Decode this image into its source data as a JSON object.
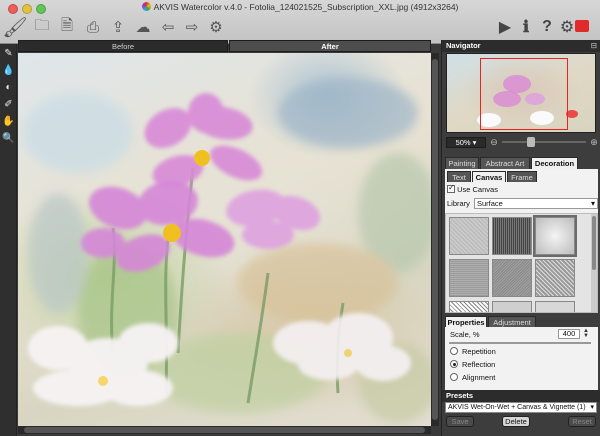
{
  "window": {
    "title": "AKVIS Watercolor v.4.0 - Fotolia_124021525_Subscription_XXL.jpg (4912x3264)"
  },
  "toolbar": {
    "left_icons": [
      "brush-logo-icon",
      "open-icon",
      "save-icon",
      "print-icon",
      "share-icon",
      "preferences-icon",
      "undo-icon",
      "redo-icon",
      "settings-gear-icon"
    ],
    "right_icons": [
      "run-icon",
      "info-icon",
      "help-icon",
      "program-settings-icon",
      "close-plugin-icon"
    ]
  },
  "tools": [
    "brush-tool-icon",
    "dropper-tool-icon",
    "color-history-icon",
    "eraser-tool-icon",
    "hand-tool-icon",
    "zoom-tool-icon"
  ],
  "view_tabs": {
    "before": "Before",
    "after": "After",
    "active": "After"
  },
  "navigator": {
    "title": "Navigator",
    "zoom": "50%",
    "zoom_slider_fraction": 0.35
  },
  "main_tabs": {
    "items": [
      "Painting",
      "Abstract Art",
      "Decoration"
    ],
    "active": "Decoration"
  },
  "sub_tabs": {
    "items": [
      "Text",
      "Canvas",
      "Frame"
    ],
    "active": "Canvas"
  },
  "canvas": {
    "use_canvas_label": "Use Canvas",
    "use_canvas_checked": true,
    "library_label": "Library",
    "library_value": "Surface",
    "selected_texture_index": 2
  },
  "properties": {
    "tabs": [
      "Properties",
      "Adjustment"
    ],
    "active": "Properties",
    "scale_label": "Scale, %",
    "scale_value": "400",
    "options": [
      "Repetition",
      "Reflection",
      "Alignment"
    ],
    "selected_option": "Reflection"
  },
  "presets": {
    "title": "Presets",
    "value": "AKVIS Wet-On-Wet + Canvas & Vignette (1)",
    "buttons": {
      "save": "Save",
      "delete": "Delete",
      "reset": "Reset"
    }
  },
  "colors": {
    "accent_close": "#e02b2b",
    "navigator_frame": "#ee2222",
    "panel_bg": "#3d3d3d",
    "flower_pink": "#d98ad6",
    "flower_center": "#f0c020"
  }
}
